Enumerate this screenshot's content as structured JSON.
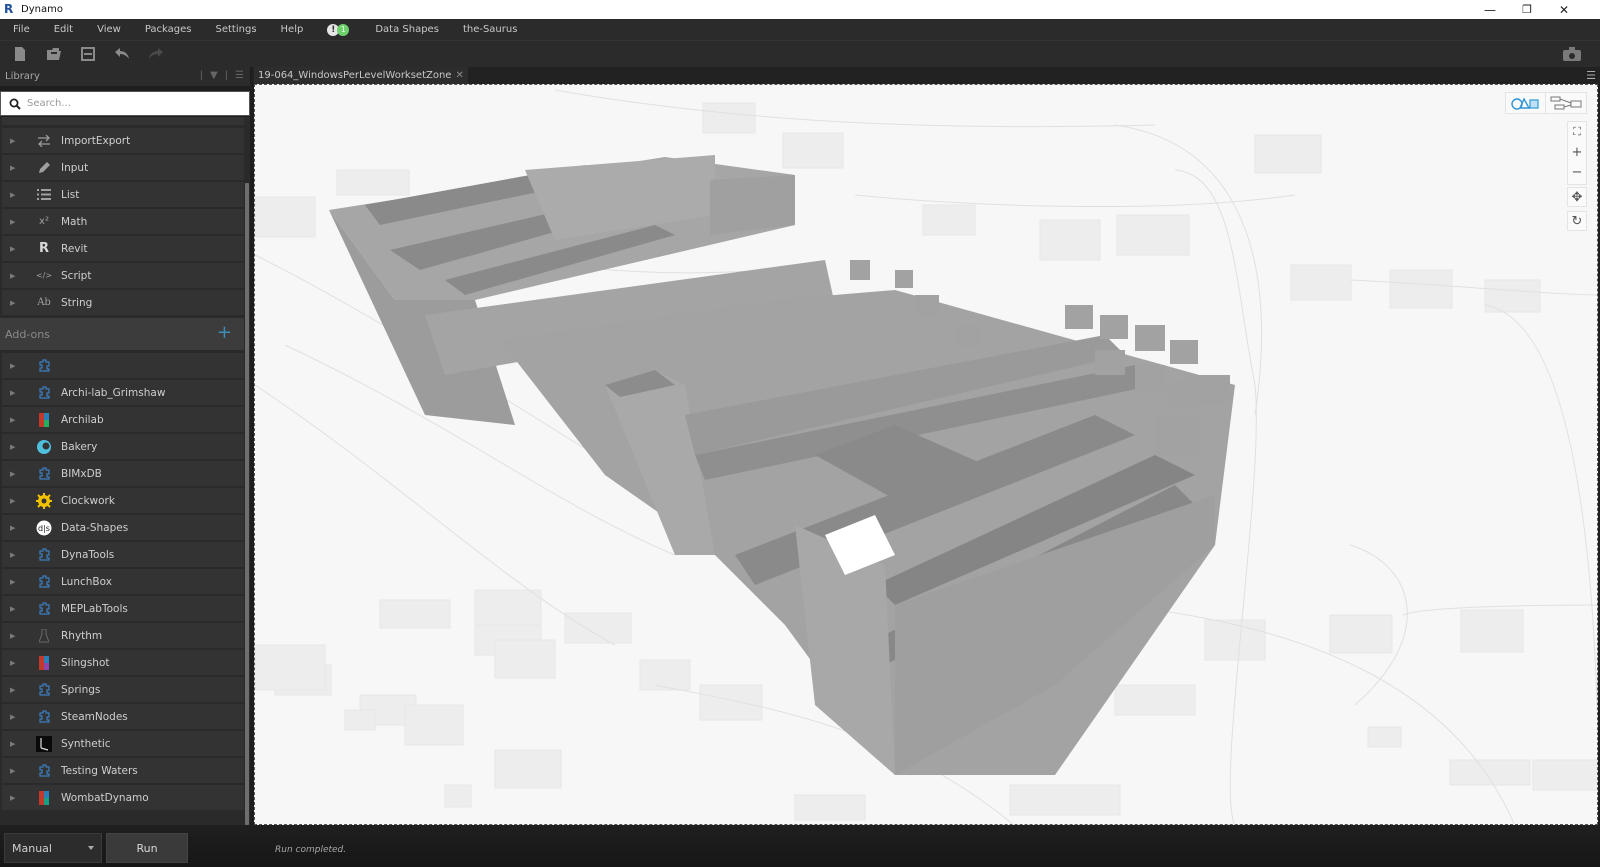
{
  "window": {
    "app_icon": "R",
    "title": "Dynamo",
    "controls": {
      "minimize": "—",
      "restore": "❐",
      "close": "✕"
    }
  },
  "menu": {
    "items": [
      "File",
      "Edit",
      "View",
      "Packages",
      "Settings",
      "Help"
    ],
    "notifications": {
      "warning": "!",
      "ok": "1"
    },
    "extra_items": [
      "Data Shapes",
      "the-Saurus"
    ]
  },
  "toolbar": {
    "buttons": [
      "new-file-icon",
      "open-file-icon",
      "save-icon",
      "undo-icon",
      "redo-icon"
    ],
    "camera": "camera-icon"
  },
  "library": {
    "title": "Library",
    "search_placeholder": "Search...",
    "categories": [
      {
        "label": "ImportExport",
        "icon": "import-export-icon"
      },
      {
        "label": "Input",
        "icon": "pencil-icon"
      },
      {
        "label": "List",
        "icon": "list-icon"
      },
      {
        "label": "Math",
        "icon": "math-icon"
      },
      {
        "label": "Revit",
        "icon": "revit-icon"
      },
      {
        "label": "Script",
        "icon": "script-icon"
      },
      {
        "label": "String",
        "icon": "string-icon"
      }
    ],
    "addons_title": "Add-ons",
    "addons_add": "+",
    "addons": [
      {
        "label": "",
        "icon": "package-icon"
      },
      {
        "label": "Archi-lab_Grimshaw",
        "icon": "package-icon"
      },
      {
        "label": "Archilab",
        "icon": "archilab-icon"
      },
      {
        "label": "Bakery",
        "icon": "bakery-icon"
      },
      {
        "label": "BIMxDB",
        "icon": "package-icon"
      },
      {
        "label": "Clockwork",
        "icon": "clockwork-icon"
      },
      {
        "label": "Data-Shapes",
        "icon": "data-shapes-icon"
      },
      {
        "label": "DynaTools",
        "icon": "package-icon"
      },
      {
        "label": "LunchBox",
        "icon": "package-icon"
      },
      {
        "label": "MEPLabTools",
        "icon": "package-icon"
      },
      {
        "label": "Rhythm",
        "icon": "rhythm-icon"
      },
      {
        "label": "Slingshot",
        "icon": "slingshot-icon"
      },
      {
        "label": "Springs",
        "icon": "package-icon"
      },
      {
        "label": "SteamNodes",
        "icon": "package-icon"
      },
      {
        "label": "Synthetic",
        "icon": "synthetic-icon"
      },
      {
        "label": "Testing Waters",
        "icon": "package-icon"
      },
      {
        "label": "WombatDynamo",
        "icon": "wombat-icon"
      }
    ]
  },
  "workspace": {
    "tab_label": "19-064_WindowsPerLevelWorksetZone",
    "tab_close": "✕",
    "view_modes": [
      "geometry-view-icon",
      "graph-view-icon"
    ],
    "zoom_controls": {
      "fit": "⛶",
      "zoom_in": "+",
      "zoom_out": "−",
      "pan": "✥",
      "orbit": "↻"
    }
  },
  "footer": {
    "run_mode": "Manual",
    "run_label": "Run",
    "status": "Run completed."
  },
  "colors": {
    "accent": "#3c8fb8",
    "notif_ok": "#6dd06d",
    "canvas_bg": "#f7f7f7",
    "chrome_bg": "#2b2b2b"
  }
}
